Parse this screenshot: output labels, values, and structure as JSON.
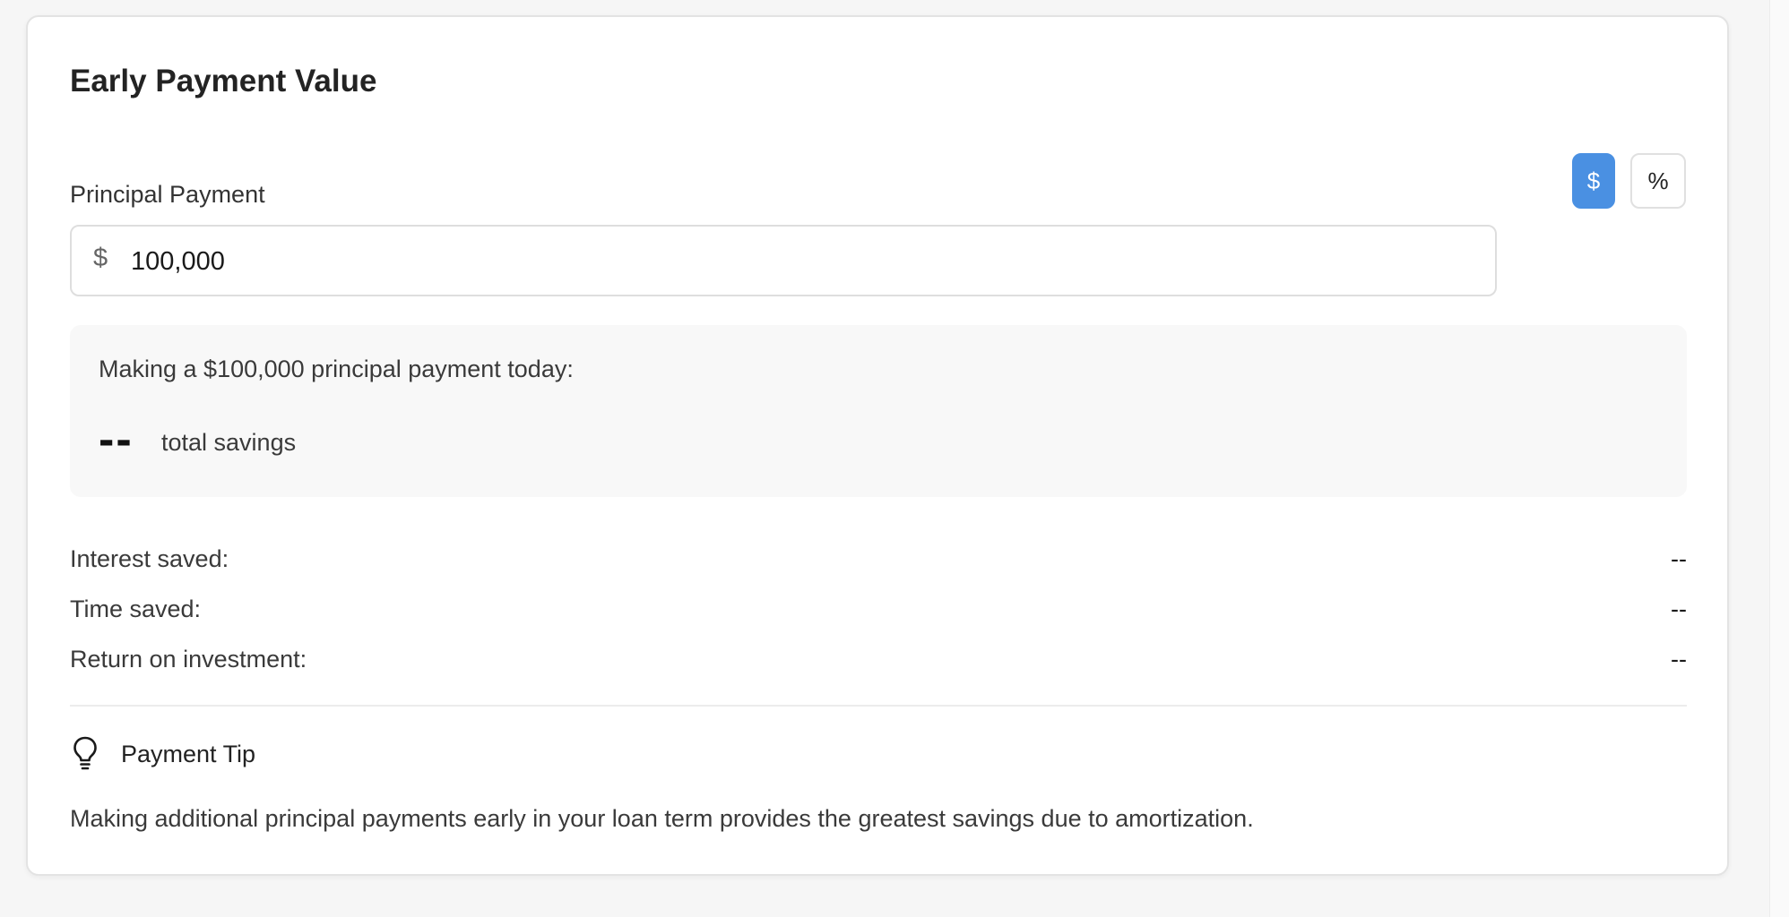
{
  "card": {
    "title": "Early Payment Value"
  },
  "principal": {
    "label": "Principal Payment",
    "mode_dollar_label": "$",
    "mode_percent_label": "%",
    "selected_mode": "$",
    "input_prefix": "$",
    "input_value": "100,000"
  },
  "summary": {
    "line": "Making a $100,000 principal payment today:",
    "total_savings_value": "--",
    "total_savings_label": "total savings"
  },
  "stats": [
    {
      "label": "Interest saved:",
      "value": "--"
    },
    {
      "label": "Time saved:",
      "value": "--"
    },
    {
      "label": "Return on investment:",
      "value": "--"
    }
  ],
  "tip": {
    "icon": "lightbulb-icon",
    "title": "Payment Tip",
    "text": "Making additional principal payments early in your loan term provides the greatest savings due to amortization."
  },
  "colors": {
    "accent": "#4a90e2",
    "background": "#f6f6f6",
    "card": "#ffffff",
    "summary_bg": "#f8f8f8"
  }
}
